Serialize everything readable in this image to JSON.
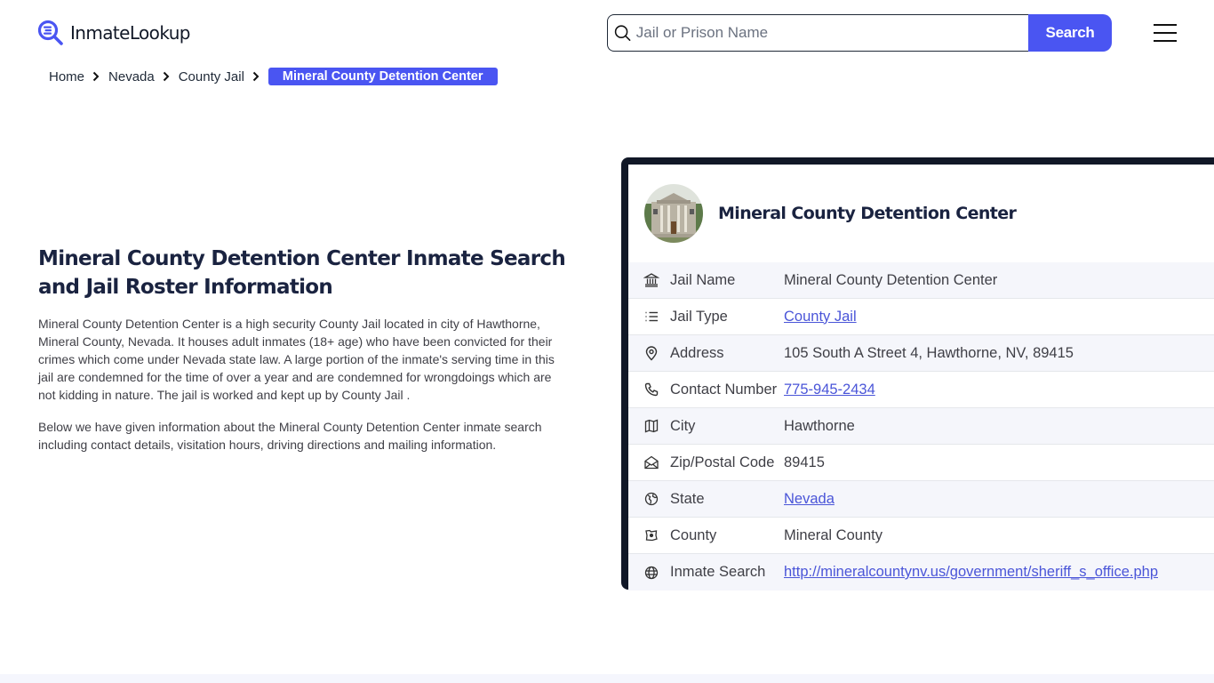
{
  "brand": {
    "name": "InmateLookup",
    "accent": "#4a55f2",
    "dark": "#111827"
  },
  "header": {
    "search_placeholder": "Jail or Prison Name",
    "search_value": "",
    "search_button": "Search",
    "menu_icon": "hamburger-icon"
  },
  "breadcrumb": {
    "items": [
      {
        "label": "Home"
      },
      {
        "label": "Nevada"
      },
      {
        "label": "County Jail"
      }
    ],
    "current": "Mineral County Detention Center"
  },
  "intro": {
    "title": "Mineral County Detention Center Inmate Search and Jail Roster Information",
    "paragraphs": [
      "Mineral County Detention Center is a high security County Jail located in city of Hawthorne, Mineral County, Nevada. It houses adult inmates (18+ age) who have been convicted for their crimes which come under Nevada state law. A large portion of the inmate's serving time in this jail are condemned for the time of over a year and are condemned for wrongdoings which are not kidding in nature. The jail is worked and kept up by County Jail .",
      "Below we have given information about the Mineral County Detention Center inmate search including contact details, visitation hours, driving directions and mailing information."
    ]
  },
  "card": {
    "name": "Mineral County Detention Center",
    "rows": [
      {
        "icon": "building-icon",
        "label": "Jail Name",
        "value": "Mineral County Detention Center",
        "link": false
      },
      {
        "icon": "list-icon",
        "label": "Jail Type",
        "value": "County Jail",
        "link": true
      },
      {
        "icon": "map-pin-icon",
        "label": "Address",
        "value": "105 South A Street 4, Hawthorne, NV, 89415",
        "link": false
      },
      {
        "icon": "phone-icon",
        "label": "Contact Number",
        "value": "775-945-2434",
        "link": true
      },
      {
        "icon": "map-icon",
        "label": "City",
        "value": "Hawthorne",
        "link": false
      },
      {
        "icon": "mail-open-icon",
        "label": "Zip/Postal Code",
        "value": "89415",
        "link": false
      },
      {
        "icon": "world-icon",
        "label": "State",
        "value": "Nevada",
        "link": true
      },
      {
        "icon": "county-map-icon",
        "label": "County",
        "value": "Mineral County",
        "link": false
      },
      {
        "icon": "globe-icon",
        "label": "Inmate Search",
        "value": "http://mineralcountynv.us/government/sheriff_s_office.php",
        "link": true
      }
    ]
  }
}
